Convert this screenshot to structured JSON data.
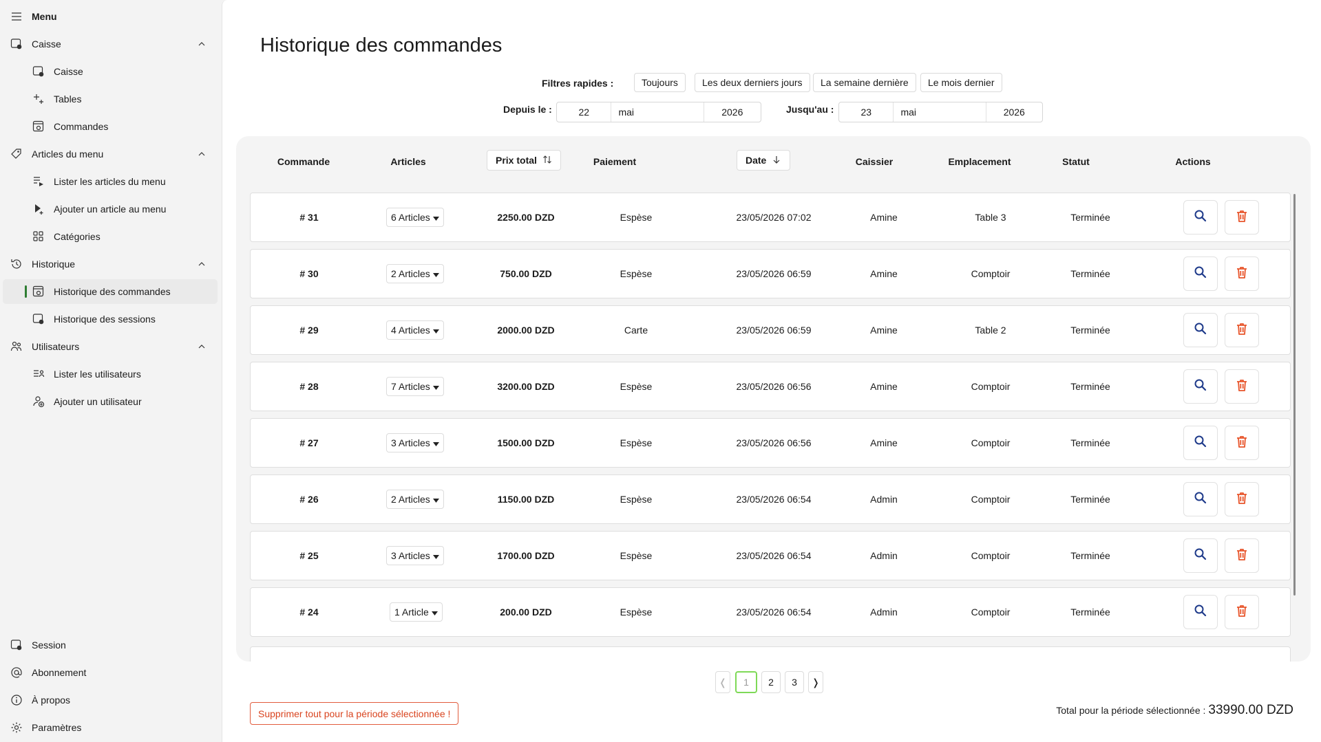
{
  "sidebar": {
    "menu_label": "Menu",
    "caisse_group": "Caisse",
    "caisse_items": [
      "Caisse",
      "Tables",
      "Commandes"
    ],
    "articles_group": "Articles du menu",
    "articles_items": [
      "Lister les articles du menu",
      "Ajouter un article au menu",
      "Catégories"
    ],
    "historique_group": "Historique",
    "historique_items": [
      "Historique des commandes",
      "Historique des sessions"
    ],
    "utilisateurs_group": "Utilisateurs",
    "utilisateurs_items": [
      "Lister les utilisateurs",
      "Ajouter un utilisateur"
    ],
    "bottom_items": [
      "Session",
      "Abonnement",
      "À propos",
      "Paramètres"
    ]
  },
  "page": {
    "title": "Historique des commandes",
    "quick_filters_label": "Filtres rapides :",
    "quick_filters": [
      "Toujours",
      "Les deux derniers jours",
      "La semaine dernière",
      "Le mois dernier"
    ],
    "from_label": "Depuis le :",
    "from_date": {
      "day": "22",
      "month": "mai",
      "year": "2026"
    },
    "to_label": "Jusqu'au :",
    "to_date": {
      "day": "23",
      "month": "mai",
      "year": "2026"
    }
  },
  "table": {
    "headers": {
      "order": "Commande",
      "articles": "Articles",
      "total": "Prix total",
      "payment": "Paiement",
      "date": "Date",
      "cashier": "Caissier",
      "location": "Emplacement",
      "status": "Statut",
      "actions": "Actions"
    },
    "rows": [
      {
        "order": "# 31",
        "articles": "6 Articles",
        "total": "2250.00 DZD",
        "payment": "Espèse",
        "date": "23/05/2026 07:02",
        "cashier": "Amine",
        "location": "Table 3",
        "status": "Terminée"
      },
      {
        "order": "# 30",
        "articles": "2 Articles",
        "total": "750.00 DZD",
        "payment": "Espèse",
        "date": "23/05/2026 06:59",
        "cashier": "Amine",
        "location": "Comptoir",
        "status": "Terminée"
      },
      {
        "order": "# 29",
        "articles": "4 Articles",
        "total": "2000.00 DZD",
        "payment": "Carte",
        "date": "23/05/2026 06:59",
        "cashier": "Amine",
        "location": "Table 2",
        "status": "Terminée"
      },
      {
        "order": "# 28",
        "articles": "7 Articles",
        "total": "3200.00 DZD",
        "payment": "Espèse",
        "date": "23/05/2026 06:56",
        "cashier": "Amine",
        "location": "Comptoir",
        "status": "Terminée"
      },
      {
        "order": "# 27",
        "articles": "3 Articles",
        "total": "1500.00 DZD",
        "payment": "Espèse",
        "date": "23/05/2026 06:56",
        "cashier": "Amine",
        "location": "Comptoir",
        "status": "Terminée"
      },
      {
        "order": "# 26",
        "articles": "2 Articles",
        "total": "1150.00 DZD",
        "payment": "Espèse",
        "date": "23/05/2026 06:54",
        "cashier": "Admin",
        "location": "Comptoir",
        "status": "Terminée"
      },
      {
        "order": "# 25",
        "articles": "3 Articles",
        "total": "1700.00 DZD",
        "payment": "Espèse",
        "date": "23/05/2026 06:54",
        "cashier": "Admin",
        "location": "Comptoir",
        "status": "Terminée"
      },
      {
        "order": "# 24",
        "articles": "1 Article",
        "total": "200.00 DZD",
        "payment": "Espèse",
        "date": "23/05/2026 06:54",
        "cashier": "Admin",
        "location": "Comptoir",
        "status": "Terminée"
      }
    ]
  },
  "pagination": {
    "prev": "❬",
    "pages": [
      "1",
      "2",
      "3"
    ],
    "current": "1",
    "next": "❭"
  },
  "footer": {
    "delete_all_label": "Supprimer tout pour la période sélectionnée !",
    "total_label": "Total pour la période sélectionnée :",
    "total_value": "33990.00 DZD"
  },
  "colors": {
    "accent_green": "#2e7d32",
    "delete_orange": "#e8542a",
    "search_blue": "#1e3a8a",
    "pager_current": "#7ed957"
  }
}
